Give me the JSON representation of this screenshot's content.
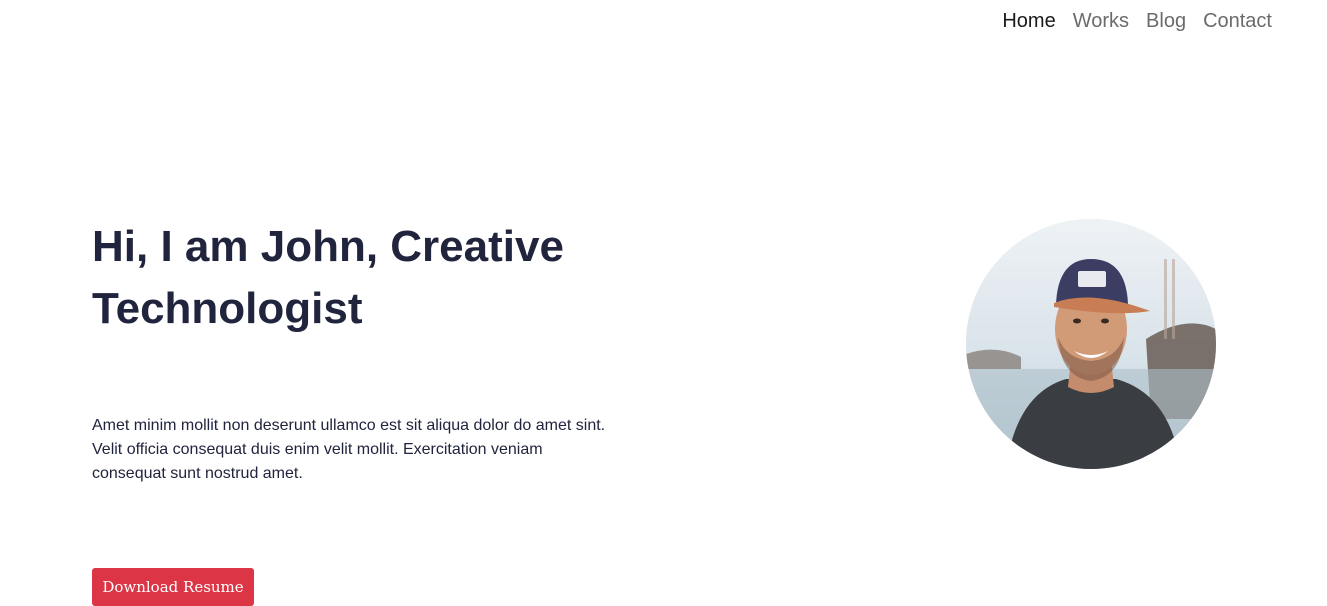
{
  "nav": {
    "items": [
      {
        "label": "Home"
      },
      {
        "label": "Works"
      },
      {
        "label": "Blog"
      },
      {
        "label": "Contact"
      }
    ],
    "active": "Home"
  },
  "hero": {
    "title": "Hi, I am John, Creative Technologist",
    "description": "Amet minim mollit non deserunt ullamco est sit aliqua dolor do amet sint. Velit officia consequat duis enim velit mollit. Exercitation veniam consequat sunt nostrud amet.",
    "button_label": "Download Resume"
  },
  "colors": {
    "heading": "#21243d",
    "button": "#dc3545",
    "nav_active": "#1b1b1b",
    "nav_inactive": "#6b6b6b"
  }
}
